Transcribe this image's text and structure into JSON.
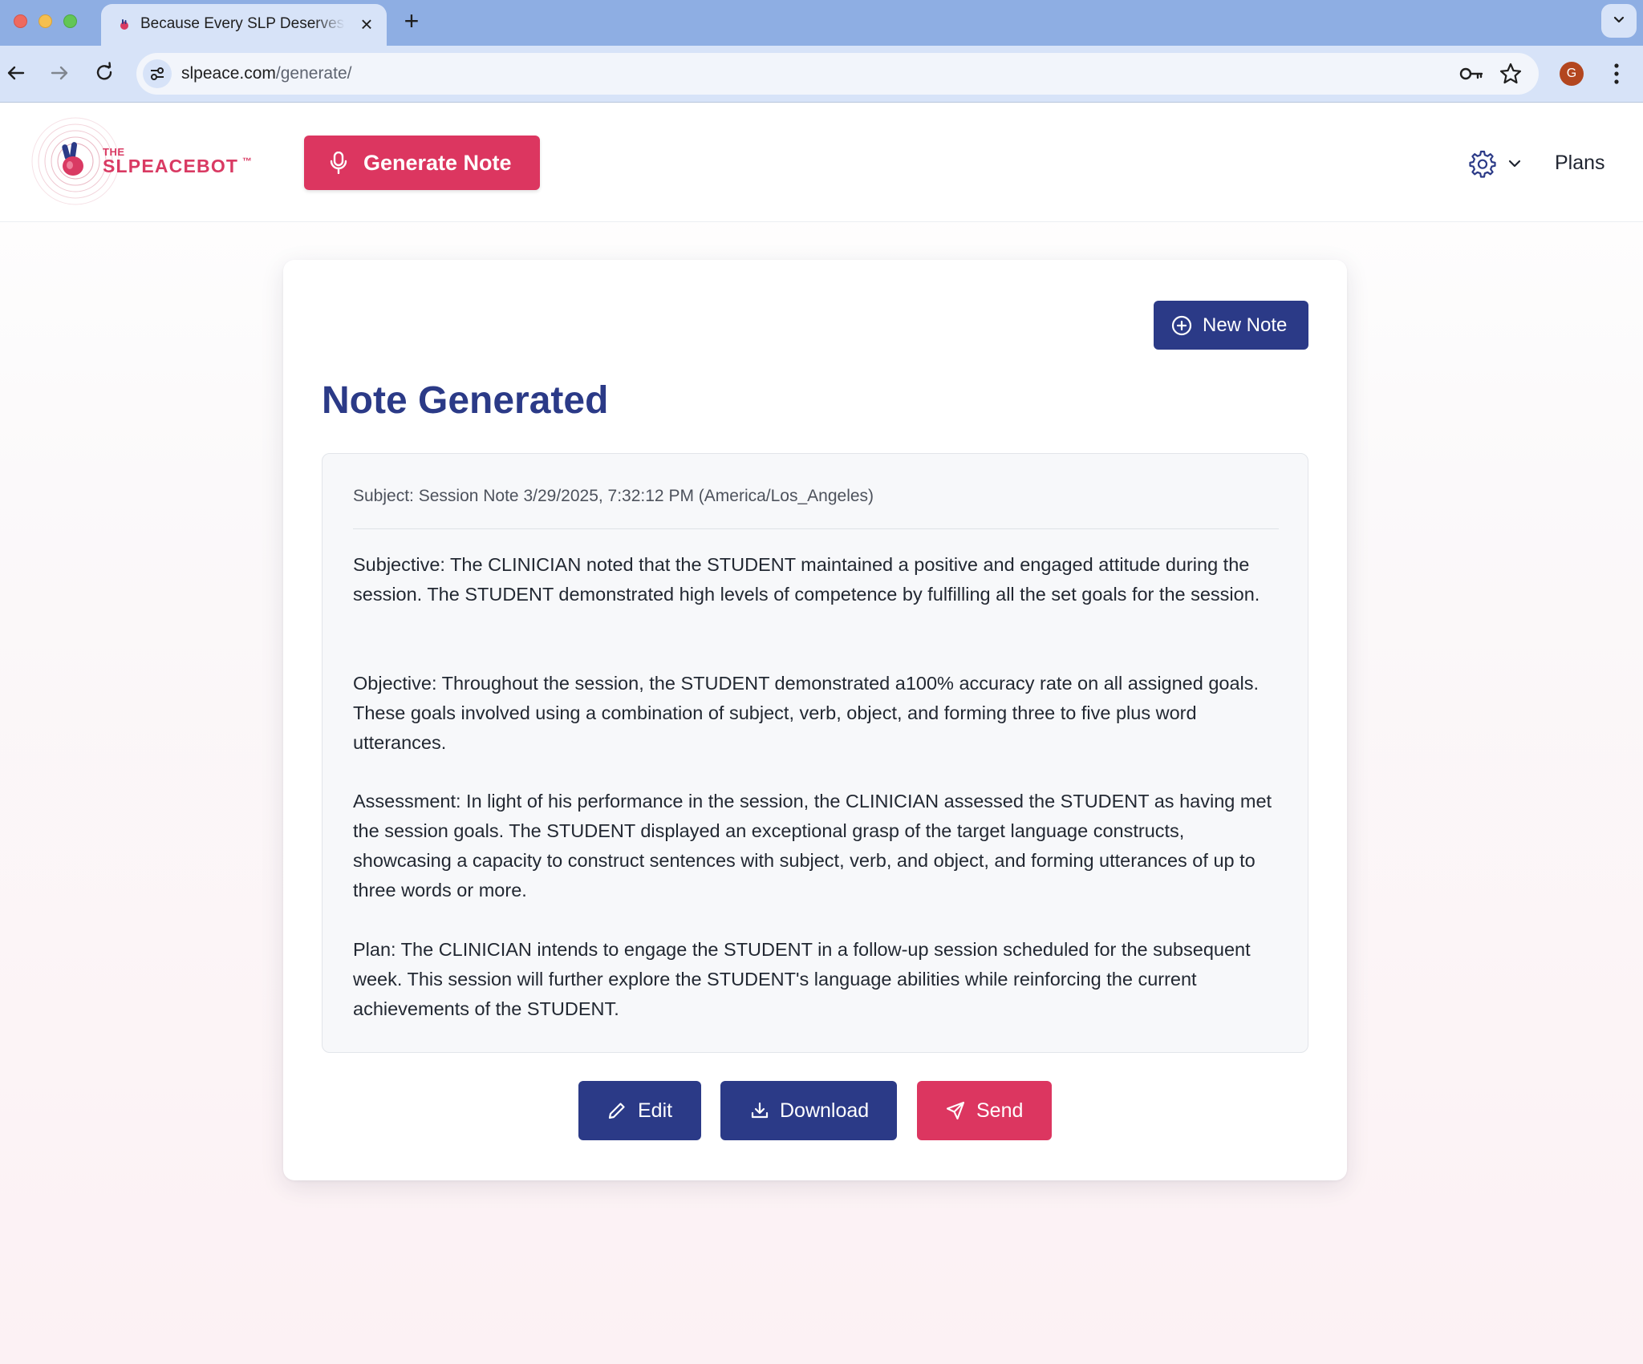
{
  "browser": {
    "tab_title": "Because Every SLP Deserves Peace",
    "url_domain": "slpeace.com",
    "url_path": "/generate/",
    "profile_initial": "G",
    "icons": [
      "close-icon",
      "plus-icon",
      "back-icon",
      "forward-icon",
      "reload-icon",
      "site-info-icon",
      "key-icon",
      "star-icon",
      "more-icon",
      "chevron-down-icon"
    ]
  },
  "header": {
    "logo_the": "THE",
    "logo_name": "SLPEACEBOT",
    "logo_tm": "™",
    "generate_label": "Generate Note",
    "plans_label": "Plans",
    "icons": [
      "microphone-icon",
      "gear-icon",
      "chevron-down-icon"
    ]
  },
  "card": {
    "new_note_label": "New Note",
    "title": "Note Generated",
    "note": {
      "subject": "Subject: Session Note 3/29/2025, 7:32:12 PM (America/Los_Angeles)",
      "subjective": "Subjective: The CLINICIAN noted that the STUDENT maintained a positive and engaged attitude during the session. The STUDENT demonstrated high levels of competence by fulfilling all the set goals for the session.",
      "objective": "Objective: Throughout the session, the STUDENT demonstrated a100% accuracy rate on all assigned goals. These goals involved using a combination of subject, verb, object, and forming three to five plus word utterances.",
      "assessment": "Assessment: In light of his performance in the session, the CLINICIAN assessed the STUDENT as having met the session goals. The STUDENT displayed an exceptional grasp of the target language constructs, showcasing a capacity to construct sentences with subject, verb, and object, and forming utterances of up to three words or more.",
      "plan": "Plan: The CLINICIAN intends to engage the STUDENT in a follow-up session scheduled for the subsequent week. This session will further explore the STUDENT's language abilities while reinforcing the current achievements of the STUDENT."
    },
    "actions": {
      "edit_label": "Edit",
      "download_label": "Download",
      "send_label": "Send"
    }
  },
  "colors": {
    "brand_pink": "#dc3660",
    "brand_navy": "#2b3a87",
    "chrome_blue": "#8eaee3"
  }
}
